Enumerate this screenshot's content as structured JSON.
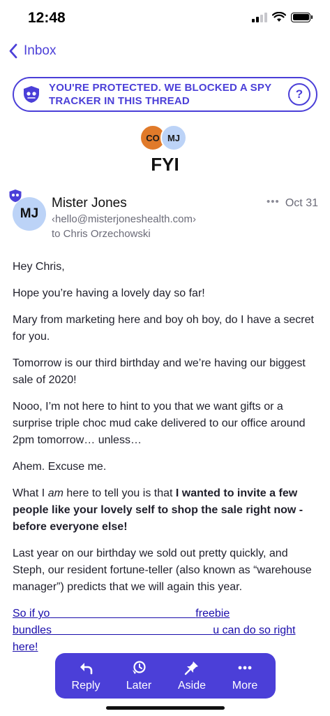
{
  "status_bar": {
    "time": "12:48"
  },
  "nav": {
    "back_label": "Inbox"
  },
  "banner": {
    "text": "YOU'RE PROTECTED. WE BLOCKED A SPY TRACKER IN THIS THREAD",
    "help_label": "?"
  },
  "thread": {
    "participants": [
      "CO",
      "MJ"
    ],
    "subject": "FYI"
  },
  "message": {
    "sender_initials": "MJ",
    "sender_name": "Mister Jones",
    "sender_email": "‹hello@misterjoneshealth.com›",
    "recipient": "to Chris Orzechowski",
    "date": "Oct 31",
    "more": "•••",
    "body": {
      "p1": "Hey Chris,",
      "p2": "Hope you’re having a lovely day so far!",
      "p3": "Mary from marketing here and boy oh boy, do I have a secret for you.",
      "p4": "Tomorrow is our third birthday and we’re having our biggest sale of 2020!",
      "p5": "Nooo, I’m not here to hint to you that we want gifts or a surprise triple choc mud cake delivered to our office around 2pm tomorrow… unless…",
      "p6": "Ahem. Excuse me.",
      "p7_a": "What I ",
      "p7_em": "am",
      "p7_b": " here to tell you is that ",
      "p7_strong": "I wanted to invite a few people like your lovely self to shop the sale right now - before everyone else!",
      "p8": "Last year on our birthday we sold out pretty quickly, and Steph, our resident fortune-teller (also known as “warehouse manager”) predicts that we will again this year.",
      "p9_a": "So if yo",
      "p9_mid": "freebie bundles",
      "p9_b": "u can do so right here!"
    }
  },
  "actions": [
    {
      "label": "Reply",
      "icon": "reply-icon"
    },
    {
      "label": "Later",
      "icon": "clock-icon"
    },
    {
      "label": "Aside",
      "icon": "pin-icon"
    },
    {
      "label": "More",
      "icon": "more-icon"
    }
  ],
  "colors": {
    "accent": "#4b3fd8",
    "avatar_co": "#e07a2a",
    "avatar_mj": "#bcd3f7"
  }
}
